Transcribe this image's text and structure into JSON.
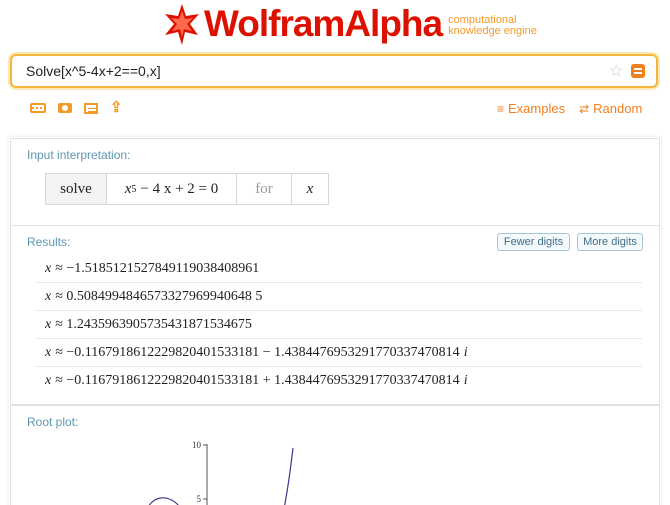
{
  "header": {
    "logo_text": "WolframAlpha",
    "tagline_line1": "computational",
    "tagline_line2": "knowledge engine",
    "brand_color": "#dd1100",
    "accent_color": "#f39b28"
  },
  "search": {
    "value": "Solve[x^5-4x+2==0,x]"
  },
  "toolbar": {
    "icons": [
      "keyboard-icon",
      "camera-icon",
      "list-icon",
      "share-icon"
    ]
  },
  "links": {
    "examples": "Examples",
    "random": "Random"
  },
  "input_interpretation": {
    "label": "Input interpretation:",
    "verb": "solve",
    "equation_base": "x",
    "equation_exp": "5",
    "equation_rest": "− 4 x + 2 = 0",
    "for": "for",
    "variable": "x"
  },
  "results": {
    "label": "Results:",
    "fewer_digits": "Fewer digits",
    "more_digits": "More digits",
    "rows": [
      {
        "lhs": "x",
        "rel": "≈",
        "value": "−1.5185121527849119038408961",
        "imag": ""
      },
      {
        "lhs": "x",
        "rel": "≈",
        "value": "0.5084994846573327969940648 5",
        "imag": ""
      },
      {
        "lhs": "x",
        "rel": "≈",
        "value": "1.2435963905735431871534675",
        "imag": ""
      },
      {
        "lhs": "x",
        "rel": "≈",
        "value": "−0.1167918612229820401533181 − 1.4384476953291770337470814",
        "imag": "i"
      },
      {
        "lhs": "x",
        "rel": "≈",
        "value": "−0.1167918612229820401533181 + 1.4384476953291770337470814",
        "imag": "i"
      }
    ]
  },
  "root_plot": {
    "label": "Root plot:",
    "y_ticks": [
      "10",
      "5"
    ]
  }
}
